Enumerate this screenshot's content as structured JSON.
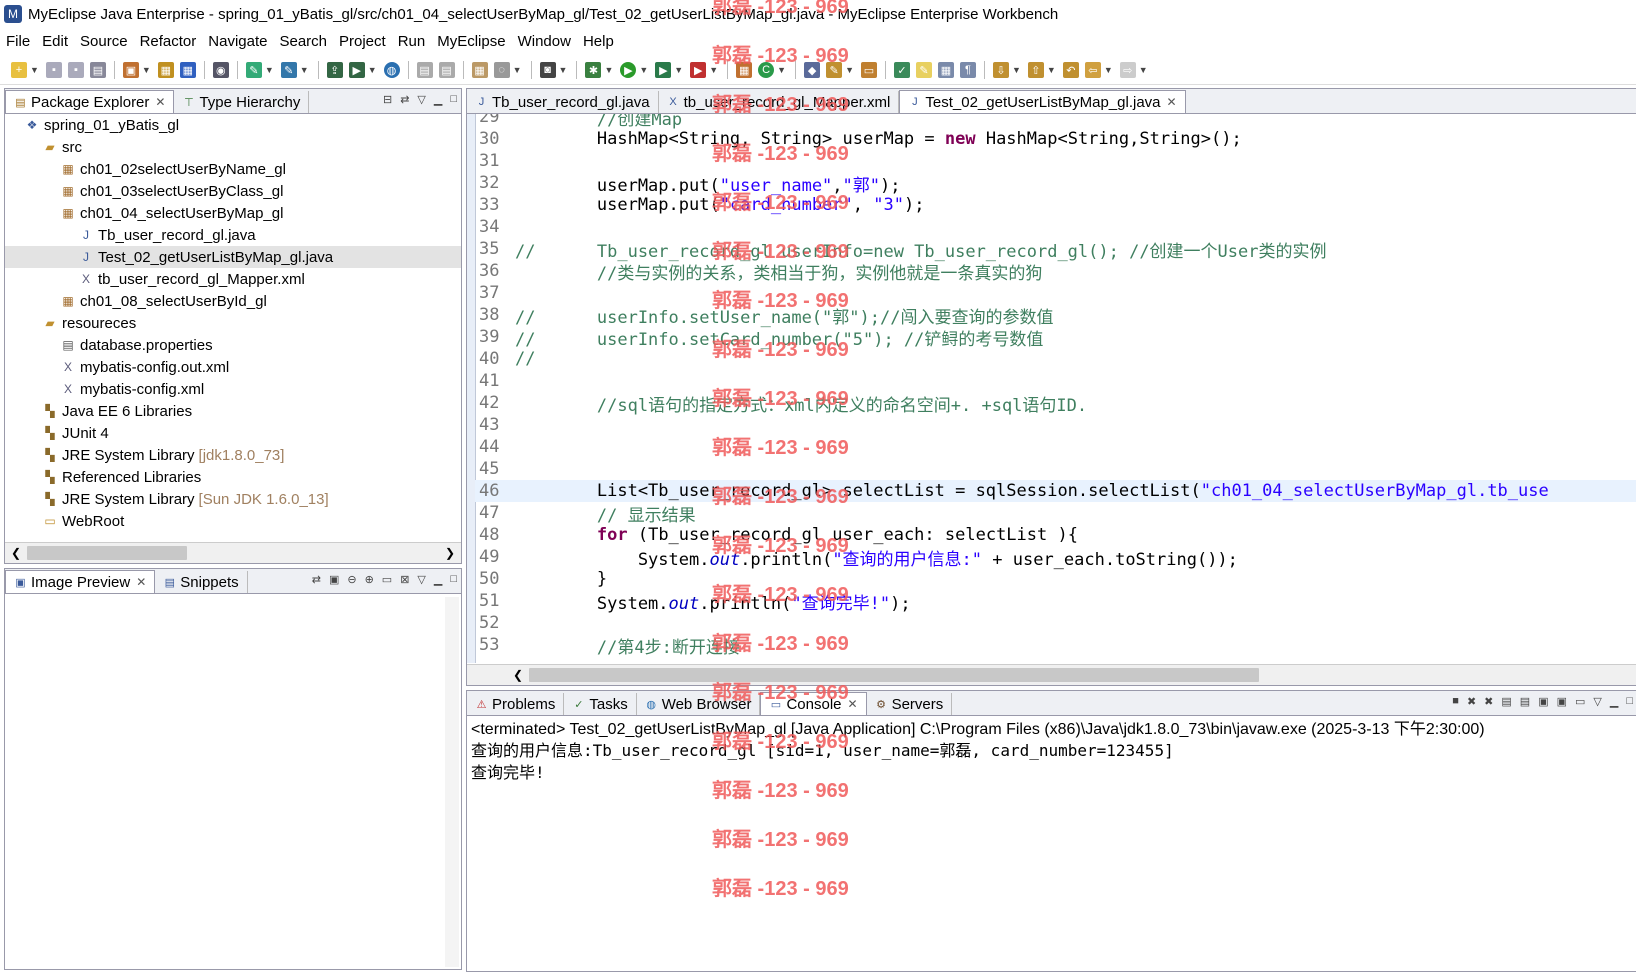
{
  "window": {
    "title": "MyEclipse Java Enterprise - spring_01_yBatis_gl/src/ch01_04_selectUserByMap_gl/Test_02_getUserListByMap_gl.java - MyEclipse Enterprise Workbench"
  },
  "menu": [
    "File",
    "Edit",
    "Source",
    "Refactor",
    "Navigate",
    "Search",
    "Project",
    "Run",
    "MyEclipse",
    "Window",
    "Help"
  ],
  "package_explorer": {
    "tabs": [
      "Package Explorer",
      "Type Hierarchy"
    ],
    "items": [
      {
        "label": "spring_01_yBatis_gl",
        "icon": "project-icon",
        "indent": 0
      },
      {
        "label": "src",
        "icon": "source-folder-icon",
        "indent": 1
      },
      {
        "label": "ch01_02selectUserByName_gl",
        "icon": "package-icon",
        "indent": 2
      },
      {
        "label": "ch01_03selectUserByClass_gl",
        "icon": "package-icon",
        "indent": 2
      },
      {
        "label": "ch01_04_selectUserByMap_gl",
        "icon": "package-icon",
        "indent": 2
      },
      {
        "label": "Tb_user_record_gl.java",
        "icon": "java-file-icon",
        "indent": 3
      },
      {
        "label": "Test_02_getUserListByMap_gl.java",
        "icon": "java-file-icon",
        "indent": 3,
        "selected": true
      },
      {
        "label": "tb_user_record_gl_Mapper.xml",
        "icon": "xml-file-icon",
        "indent": 3
      },
      {
        "label": "ch01_08_selectUserById_gl",
        "icon": "package-icon",
        "indent": 2
      },
      {
        "label": "resoureces",
        "icon": "source-folder-icon",
        "indent": 1
      },
      {
        "label": "database.properties",
        "icon": "properties-file-icon",
        "indent": 2
      },
      {
        "label": "mybatis-config.out.xml",
        "icon": "xml-file-icon",
        "indent": 2
      },
      {
        "label": "mybatis-config.xml",
        "icon": "xml-file-icon",
        "indent": 2
      },
      {
        "label": "Java EE 6 Libraries",
        "icon": "library-icon",
        "indent": 1
      },
      {
        "label": "JUnit 4",
        "icon": "library-icon",
        "indent": 1
      },
      {
        "label": "JRE System Library",
        "icon": "library-icon",
        "indent": 1,
        "suffix": "[jdk1.8.0_73]"
      },
      {
        "label": "Referenced Libraries",
        "icon": "library-icon",
        "indent": 1
      },
      {
        "label": "JRE System Library",
        "icon": "library-icon",
        "indent": 1,
        "suffix": "[Sun JDK 1.6.0_13]"
      },
      {
        "label": "WebRoot",
        "icon": "folder-icon",
        "indent": 1
      }
    ]
  },
  "image_preview": {
    "tabs": [
      "Image Preview",
      "Snippets"
    ]
  },
  "editor": {
    "tabs": [
      "Tb_user_record_gl.java",
      "tb_user_record_gl_Mapper.xml",
      "Test_02_getUserListByMap_gl.java"
    ],
    "lines": [
      {
        "n": "29",
        "segs": [
          [
            "        ",
            ""
          ],
          [
            "//创建Map",
            "cm"
          ]
        ]
      },
      {
        "n": "30",
        "segs": [
          [
            "        HashMap<String, String> userMap = ",
            ""
          ],
          [
            "new",
            "kw"
          ],
          [
            " HashMap<String,String>();",
            ""
          ]
        ]
      },
      {
        "n": "31",
        "segs": [
          [
            "",
            ""
          ]
        ]
      },
      {
        "n": "32",
        "segs": [
          [
            "        userMap.put(",
            ""
          ],
          [
            "\"user_name\"",
            "str"
          ],
          [
            ",",
            ""
          ],
          [
            "\"郭\"",
            "str"
          ],
          [
            ");",
            ""
          ]
        ]
      },
      {
        "n": "33",
        "segs": [
          [
            "        userMap.put(",
            ""
          ],
          [
            "\"card_number\"",
            "str"
          ],
          [
            ", ",
            ""
          ],
          [
            "\"3\"",
            "str"
          ],
          [
            ");",
            ""
          ]
        ]
      },
      {
        "n": "34",
        "segs": [
          [
            "",
            ""
          ]
        ]
      },
      {
        "n": "35",
        "segs": [
          [
            "//      Tb_user_record_gl userInfo=new Tb_user_record_gl(); //创建一个User类的实例",
            "cm"
          ]
        ]
      },
      {
        "n": "36",
        "segs": [
          [
            "        ",
            ""
          ],
          [
            "//类与实例的关系，类相当于狗，实例他就是一条真实的狗",
            "cm"
          ]
        ]
      },
      {
        "n": "37",
        "segs": [
          [
            "",
            ""
          ]
        ]
      },
      {
        "n": "38",
        "segs": [
          [
            "//      userInfo.setUser_name(\"郭\");//闯入要查询的参数值",
            "cm"
          ]
        ]
      },
      {
        "n": "39",
        "segs": [
          [
            "//      userInfo.setCard_number(\"5\"); //铲鲟的考号数值",
            "cm"
          ]
        ]
      },
      {
        "n": "40",
        "segs": [
          [
            "//",
            "cm"
          ]
        ]
      },
      {
        "n": "41",
        "segs": [
          [
            "",
            ""
          ]
        ]
      },
      {
        "n": "42",
        "segs": [
          [
            "        ",
            ""
          ],
          [
            "//sql语句的指定方式：xml内定义的命名空间+. +sql语句ID.",
            "cm"
          ]
        ]
      },
      {
        "n": "43",
        "segs": [
          [
            "",
            ""
          ]
        ]
      },
      {
        "n": "44",
        "segs": [
          [
            "",
            ""
          ]
        ]
      },
      {
        "n": "45",
        "segs": [
          [
            "",
            ""
          ]
        ]
      },
      {
        "n": "46",
        "segs": [
          [
            "        List<Tb_user_record_gl> selectList = sqlSession.selectList(",
            ""
          ],
          [
            "\"ch01_04_selectUserByMap_gl.tb_use",
            "str"
          ]
        ],
        "highlight": true
      },
      {
        "n": "47",
        "segs": [
          [
            "        ",
            ""
          ],
          [
            "// 显示结果",
            "cm"
          ]
        ]
      },
      {
        "n": "48",
        "segs": [
          [
            "        ",
            ""
          ],
          [
            "for",
            "kw"
          ],
          [
            " (Tb_user_record_gl user_each: selectList ){",
            ""
          ]
        ]
      },
      {
        "n": "49",
        "segs": [
          [
            "            System.",
            ""
          ],
          [
            "out",
            "fld"
          ],
          [
            ".println(",
            ""
          ],
          [
            "\"查询的用户信息:\"",
            "str"
          ],
          [
            " + user_each.toString());",
            ""
          ]
        ]
      },
      {
        "n": "50",
        "segs": [
          [
            "        }",
            ""
          ]
        ]
      },
      {
        "n": "51",
        "segs": [
          [
            "        System.",
            ""
          ],
          [
            "out",
            "fld"
          ],
          [
            ".println(",
            ""
          ],
          [
            "\"查询完毕!\"",
            "str"
          ],
          [
            ");",
            ""
          ]
        ]
      },
      {
        "n": "52",
        "segs": [
          [
            "",
            ""
          ]
        ]
      },
      {
        "n": "53",
        "segs": [
          [
            "        ",
            ""
          ],
          [
            "//第4步:断开连接",
            "cm"
          ]
        ]
      }
    ]
  },
  "console": {
    "tabs": [
      "Problems",
      "Tasks",
      "Web Browser",
      "Console",
      "Servers"
    ],
    "header": "<terminated> Test_02_getUserListByMap_gl [Java Application] C:\\Program Files (x86)\\Java\\jdk1.8.0_73\\bin\\javaw.exe (2025-3-13 下午2:30:00)",
    "output": [
      "查询的用户信息:Tb_user_record_gl [sid=1, user_name=郭磊, card_number=123455]",
      "查询完毕!"
    ]
  },
  "watermark": "郭磊 -123 - 969"
}
